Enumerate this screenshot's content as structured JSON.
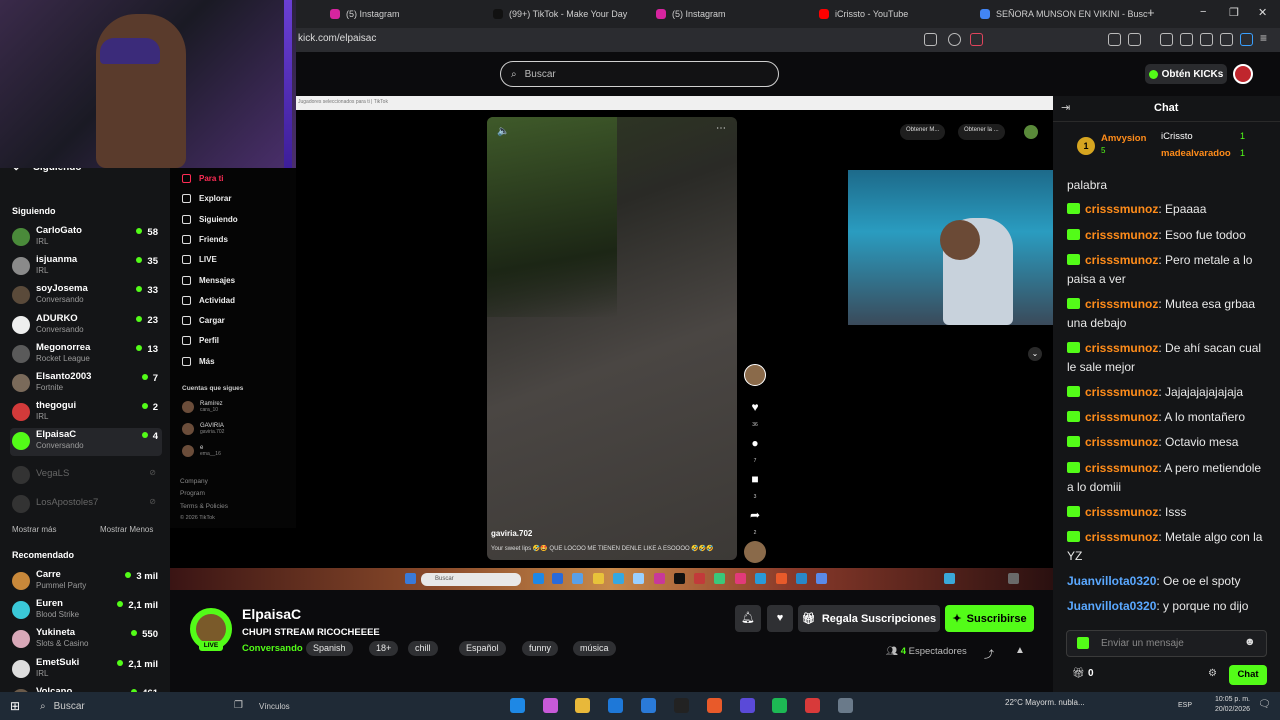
{
  "browser": {
    "tabs": [
      {
        "label": "(5) Instagram",
        "color": "#d6249f"
      },
      {
        "label": "(99+) TikTok - Make Your Day",
        "color": "#111111"
      },
      {
        "label": "(5) Instagram",
        "color": "#d6249f"
      },
      {
        "label": "iCrissto - YouTube",
        "color": "#ff0000"
      },
      {
        "label": "SEÑORA MUNSON EN VIKINI - Busc",
        "color": "#4285f4"
      }
    ],
    "new_tab": "+",
    "url": "kick.com/elpaisac",
    "win_min": "−",
    "win_max": "❐",
    "win_close": "✕"
  },
  "kick": {
    "search_placeholder": "Buscar",
    "get_kicks": "Obtén KICKs"
  },
  "sidebar": {
    "siguiendo_toggle": "Siguiendo",
    "following_header": "Siguiendo",
    "following": [
      {
        "name": "CarloGato",
        "category": "IRL",
        "viewers": "58",
        "color": "#4a8a3a"
      },
      {
        "name": "isjuanma",
        "category": "IRL",
        "viewers": "35",
        "color": "#8a8a8a"
      },
      {
        "name": "soyJosema",
        "category": "Conversando",
        "viewers": "33",
        "color": "#5a4a3a"
      },
      {
        "name": "ADURKO",
        "category": "Conversando",
        "viewers": "23",
        "color": "#eeeeee"
      },
      {
        "name": "Megonorrea",
        "category": "Rocket League",
        "viewers": "13",
        "color": "#5a5a5a"
      },
      {
        "name": "Elsanto2003",
        "category": "Fortnite",
        "viewers": "7",
        "color": "#7a6a5a"
      },
      {
        "name": "thegogui",
        "category": "IRL",
        "viewers": "2",
        "color": "#d23a3a"
      },
      {
        "name": "ElpaisaC",
        "category": "Conversando",
        "viewers": "4",
        "color": "#53fc18"
      }
    ],
    "offline": [
      "VegaLS",
      "LosApostoles7"
    ],
    "show_more": "Mostrar más",
    "show_less": "Mostrar Menos",
    "recommended_header": "Recomendado",
    "recommended": [
      {
        "name": "Carre",
        "category": "Pummel Party",
        "viewers": "3 mil",
        "color": "#c8883a"
      },
      {
        "name": "Euren",
        "category": "Blood Strike",
        "viewers": "2,1 mil",
        "color": "#3ac8d8"
      },
      {
        "name": "Yukineta",
        "category": "Slots & Casino",
        "viewers": "550",
        "color": "#d8a8b8"
      },
      {
        "name": "EmetSuki",
        "category": "IRL",
        "viewers": "2,1 mil",
        "color": "#dddddd"
      },
      {
        "name": "Volcano",
        "category": "",
        "viewers": "461",
        "color": "#6a5a4a"
      }
    ]
  },
  "tiktok": {
    "topbar": "Jugadores seleccionados para ti | TikTok",
    "nav": [
      "Para ti",
      "Explorar",
      "Siguiendo",
      "Friends",
      "LIVE",
      "Mensajes",
      "Actividad",
      "Cargar",
      "Perfil",
      "Más"
    ],
    "accounts_header": "Cuentas que sigues",
    "accounts": [
      {
        "name": "Ramírez",
        "handle": "cara_10"
      },
      {
        "name": "GAVIRIA",
        "handle": "gaviria.702"
      },
      {
        "name": "e",
        "handle": "ema__16"
      }
    ],
    "footer": [
      "Company",
      "Program",
      "Terms & Policies",
      "© 2026 TikTok"
    ],
    "video_handle": "gaviria.702",
    "video_caption": "Your sweet lips 🤣🤩 QUE LOCOO ME TIENEN DENLE LIKE A ESOOOO 🤣🤣🤣",
    "actions": [
      {
        "icon": "♥",
        "count": "36"
      },
      {
        "icon": "●",
        "count": "7"
      },
      {
        "icon": "■",
        "count": "3"
      },
      {
        "icon": "➦",
        "count": "2"
      }
    ],
    "top_buttons": [
      "Obtener M...",
      "Obtener la ..."
    ],
    "strip_search": "Buscar"
  },
  "stream": {
    "name": "ElpaisaC",
    "title": "CHUPI STREAM RICOCHEEEE",
    "category": "Conversando",
    "live": "LIVE",
    "tags": [
      "Spanish",
      "18+",
      "chill",
      "Español",
      "funny",
      "música"
    ],
    "gift_label": "Regala Suscripciones",
    "subscribe_label": "Suscribirse",
    "viewers_count": "4",
    "viewers_label": "Espectadores"
  },
  "chat": {
    "title": "Chat",
    "pinned": [
      {
        "rank": "1",
        "name": "Amvysion",
        "value": "5"
      },
      {
        "name": "iCrissto",
        "value": "1"
      },
      {
        "name": "madealvaradoo",
        "value": "1"
      }
    ],
    "partial": "palabra",
    "messages": [
      {
        "user": "crisssmunoz",
        "text": ": Epaaaa",
        "badge": true,
        "blue": false
      },
      {
        "user": "crisssmunoz",
        "text": ": Esoo fue todoo",
        "badge": true,
        "blue": false
      },
      {
        "user": "crisssmunoz",
        "text": ": Pero metale a lo paisa a ver",
        "badge": true,
        "blue": false
      },
      {
        "user": "crisssmunoz",
        "text": ": Mutea esa grbaa una debajo",
        "badge": true,
        "blue": false
      },
      {
        "user": "crisssmunoz",
        "text": ": De ahí sacan cual le sale mejor",
        "badge": true,
        "blue": false
      },
      {
        "user": "crisssmunoz",
        "text": ": Jajajajajajajaja",
        "badge": true,
        "blue": false
      },
      {
        "user": "crisssmunoz",
        "text": ": A lo montañero",
        "badge": true,
        "blue": false
      },
      {
        "user": "crisssmunoz",
        "text": ": Octavio mesa",
        "badge": true,
        "blue": false
      },
      {
        "user": "crisssmunoz",
        "text": ": A pero metiendole a lo domiii",
        "badge": true,
        "blue": false
      },
      {
        "user": "crisssmunoz",
        "text": ": Isss",
        "badge": true,
        "blue": false
      },
      {
        "user": "crisssmunoz",
        "text": ": Metale algo con la YZ",
        "badge": true,
        "blue": false
      },
      {
        "user": "Juanvillota0320",
        "text": ": Oe oe el spoty",
        "badge": false,
        "blue": true
      },
      {
        "user": "Juanvillota0320",
        "text": ": y porque no dijo",
        "badge": false,
        "blue": true
      }
    ],
    "input_placeholder": "Enviar un mensaje",
    "points": "0",
    "send_label": "Chat"
  },
  "taskbar": {
    "search": "Buscar",
    "links": "Vínculos",
    "weather": "22°C  Mayorm. nubla...",
    "lang": "ESP",
    "time": "10:05 p. m.",
    "date": "20/02/2026"
  }
}
